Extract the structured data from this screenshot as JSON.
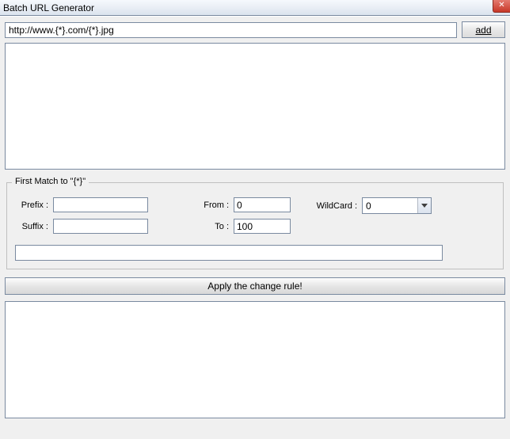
{
  "window": {
    "title": "Batch URL Generator",
    "close_glyph": "✕"
  },
  "top": {
    "url_value": "http://www.{*}.com/{*}.jpg",
    "add_label": "add"
  },
  "group": {
    "legend": "First Match to \"{*}\"",
    "prefix_label": "Prefix :",
    "prefix_value": "",
    "suffix_label": "Suffix :",
    "suffix_value": "",
    "from_label": "From :",
    "from_value": "0",
    "to_label": "To :",
    "to_value": "100",
    "wildcard_label": "WildCard :",
    "wildcard_value": "0",
    "long_value": ""
  },
  "apply": {
    "label": "Apply the change rule!"
  }
}
